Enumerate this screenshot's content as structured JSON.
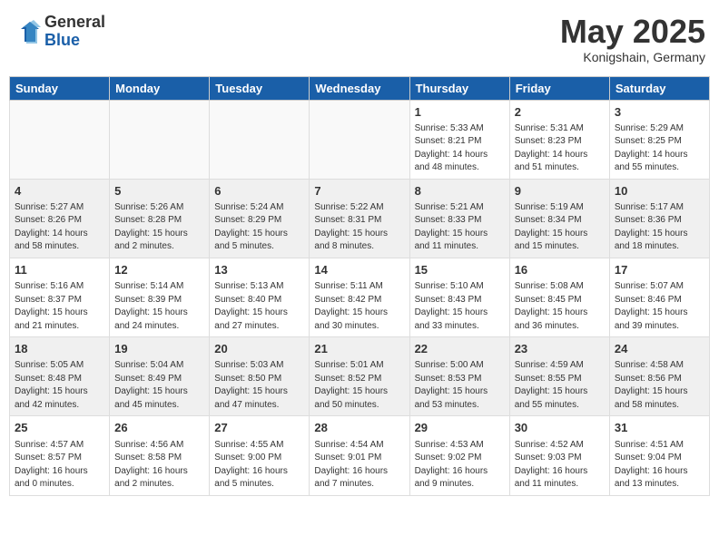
{
  "header": {
    "logo": {
      "general": "General",
      "blue": "Blue"
    },
    "title": "May 2025",
    "subtitle": "Konigshain, Germany"
  },
  "weekdays": [
    "Sunday",
    "Monday",
    "Tuesday",
    "Wednesday",
    "Thursday",
    "Friday",
    "Saturday"
  ],
  "weeks": [
    [
      {
        "day": "",
        "info": ""
      },
      {
        "day": "",
        "info": ""
      },
      {
        "day": "",
        "info": ""
      },
      {
        "day": "",
        "info": ""
      },
      {
        "day": "1",
        "info": "Sunrise: 5:33 AM\nSunset: 8:21 PM\nDaylight: 14 hours and 48 minutes."
      },
      {
        "day": "2",
        "info": "Sunrise: 5:31 AM\nSunset: 8:23 PM\nDaylight: 14 hours and 51 minutes."
      },
      {
        "day": "3",
        "info": "Sunrise: 5:29 AM\nSunset: 8:25 PM\nDaylight: 14 hours and 55 minutes."
      }
    ],
    [
      {
        "day": "4",
        "info": "Sunrise: 5:27 AM\nSunset: 8:26 PM\nDaylight: 14 hours and 58 minutes."
      },
      {
        "day": "5",
        "info": "Sunrise: 5:26 AM\nSunset: 8:28 PM\nDaylight: 15 hours and 2 minutes."
      },
      {
        "day": "6",
        "info": "Sunrise: 5:24 AM\nSunset: 8:29 PM\nDaylight: 15 hours and 5 minutes."
      },
      {
        "day": "7",
        "info": "Sunrise: 5:22 AM\nSunset: 8:31 PM\nDaylight: 15 hours and 8 minutes."
      },
      {
        "day": "8",
        "info": "Sunrise: 5:21 AM\nSunset: 8:33 PM\nDaylight: 15 hours and 11 minutes."
      },
      {
        "day": "9",
        "info": "Sunrise: 5:19 AM\nSunset: 8:34 PM\nDaylight: 15 hours and 15 minutes."
      },
      {
        "day": "10",
        "info": "Sunrise: 5:17 AM\nSunset: 8:36 PM\nDaylight: 15 hours and 18 minutes."
      }
    ],
    [
      {
        "day": "11",
        "info": "Sunrise: 5:16 AM\nSunset: 8:37 PM\nDaylight: 15 hours and 21 minutes."
      },
      {
        "day": "12",
        "info": "Sunrise: 5:14 AM\nSunset: 8:39 PM\nDaylight: 15 hours and 24 minutes."
      },
      {
        "day": "13",
        "info": "Sunrise: 5:13 AM\nSunset: 8:40 PM\nDaylight: 15 hours and 27 minutes."
      },
      {
        "day": "14",
        "info": "Sunrise: 5:11 AM\nSunset: 8:42 PM\nDaylight: 15 hours and 30 minutes."
      },
      {
        "day": "15",
        "info": "Sunrise: 5:10 AM\nSunset: 8:43 PM\nDaylight: 15 hours and 33 minutes."
      },
      {
        "day": "16",
        "info": "Sunrise: 5:08 AM\nSunset: 8:45 PM\nDaylight: 15 hours and 36 minutes."
      },
      {
        "day": "17",
        "info": "Sunrise: 5:07 AM\nSunset: 8:46 PM\nDaylight: 15 hours and 39 minutes."
      }
    ],
    [
      {
        "day": "18",
        "info": "Sunrise: 5:05 AM\nSunset: 8:48 PM\nDaylight: 15 hours and 42 minutes."
      },
      {
        "day": "19",
        "info": "Sunrise: 5:04 AM\nSunset: 8:49 PM\nDaylight: 15 hours and 45 minutes."
      },
      {
        "day": "20",
        "info": "Sunrise: 5:03 AM\nSunset: 8:50 PM\nDaylight: 15 hours and 47 minutes."
      },
      {
        "day": "21",
        "info": "Sunrise: 5:01 AM\nSunset: 8:52 PM\nDaylight: 15 hours and 50 minutes."
      },
      {
        "day": "22",
        "info": "Sunrise: 5:00 AM\nSunset: 8:53 PM\nDaylight: 15 hours and 53 minutes."
      },
      {
        "day": "23",
        "info": "Sunrise: 4:59 AM\nSunset: 8:55 PM\nDaylight: 15 hours and 55 minutes."
      },
      {
        "day": "24",
        "info": "Sunrise: 4:58 AM\nSunset: 8:56 PM\nDaylight: 15 hours and 58 minutes."
      }
    ],
    [
      {
        "day": "25",
        "info": "Sunrise: 4:57 AM\nSunset: 8:57 PM\nDaylight: 16 hours and 0 minutes."
      },
      {
        "day": "26",
        "info": "Sunrise: 4:56 AM\nSunset: 8:58 PM\nDaylight: 16 hours and 2 minutes."
      },
      {
        "day": "27",
        "info": "Sunrise: 4:55 AM\nSunset: 9:00 PM\nDaylight: 16 hours and 5 minutes."
      },
      {
        "day": "28",
        "info": "Sunrise: 4:54 AM\nSunset: 9:01 PM\nDaylight: 16 hours and 7 minutes."
      },
      {
        "day": "29",
        "info": "Sunrise: 4:53 AM\nSunset: 9:02 PM\nDaylight: 16 hours and 9 minutes."
      },
      {
        "day": "30",
        "info": "Sunrise: 4:52 AM\nSunset: 9:03 PM\nDaylight: 16 hours and 11 minutes."
      },
      {
        "day": "31",
        "info": "Sunrise: 4:51 AM\nSunset: 9:04 PM\nDaylight: 16 hours and 13 minutes."
      }
    ]
  ]
}
